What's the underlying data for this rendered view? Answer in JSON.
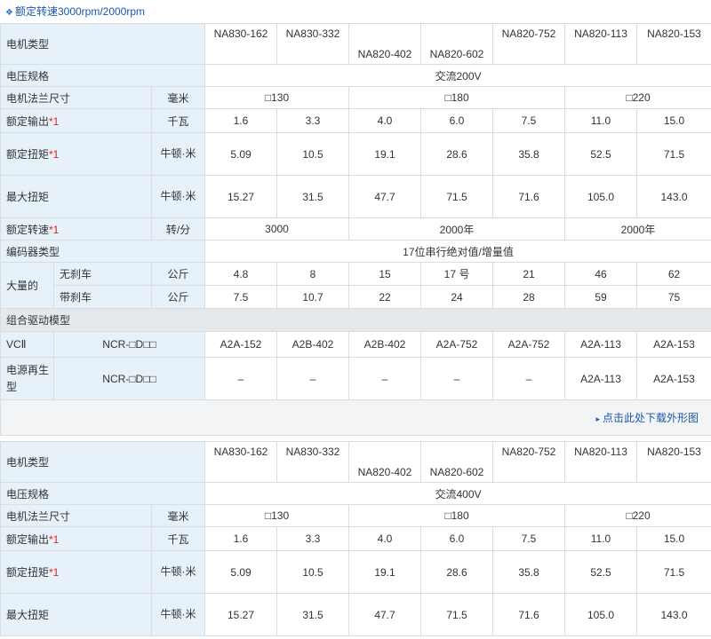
{
  "header": {
    "title": "额定转速3000rpm/2000rpm"
  },
  "labels": {
    "motor_type": "电机类型",
    "voltage": "电压规格",
    "flange": "电机法兰尺寸",
    "output": "额定输出",
    "torque": "额定扭矩",
    "max_torque": "最大扭矩",
    "speed": "额定转速",
    "encoder": "编码器类型",
    "mass": "大量的",
    "no_brake": "无刹车",
    "with_brake": "带刹车",
    "drive_group": "组合驱动模型",
    "vc2": "VCⅡ",
    "regen": "电源再生型",
    "asterisk": "*1"
  },
  "units": {
    "mm": "毫米",
    "kw": "千瓦",
    "nm": "牛顿·米",
    "rpm": "转/分",
    "kg": "公斤"
  },
  "models": [
    "NA830-162",
    "NA830-332",
    "NA820-402",
    "NA820-602",
    "NA820-752",
    "NA820-113",
    "NA820-153"
  ],
  "drive_prefix": "NCR-□D□□",
  "download_link": "点击此处下载外形图",
  "table1": {
    "voltage": "交流200V",
    "flange": [
      "□130",
      "□180",
      "□220"
    ],
    "output": [
      "1.6",
      "3.3",
      "4.0",
      "6.0",
      "7.5",
      "11.0",
      "15.0"
    ],
    "torque": [
      "5.09",
      "10.5",
      "19.1",
      "28.6",
      "35.8",
      "52.5",
      "71.5"
    ],
    "max_torque": [
      "15.27",
      "31.5",
      "47.7",
      "71.5",
      "71.6",
      "105.0",
      "143.0"
    ],
    "speed": [
      "3000",
      "2000年",
      "2000年"
    ],
    "encoder": "17位串行绝对值/增量值",
    "mass_no_brake": [
      "4.8",
      "8",
      "15",
      "17 号",
      "21",
      "46",
      "62"
    ],
    "mass_with_brake": [
      "7.5",
      "10.7",
      "22",
      "24",
      "28",
      "59",
      "75"
    ],
    "drive_vc2": [
      "A2A-152",
      "A2B-402",
      "A2B-402",
      "A2A-752",
      "A2A-752",
      "A2A-113",
      "A2A-153"
    ],
    "drive_regen": [
      "–",
      "–",
      "–",
      "–",
      "–",
      "A2A-113",
      "A2A-153"
    ]
  },
  "table2": {
    "voltage": "交流400V",
    "flange": [
      "□130",
      "□180",
      "□220"
    ],
    "output": [
      "1.6",
      "3.3",
      "4.0",
      "6.0",
      "7.5",
      "11.0",
      "15.0"
    ],
    "torque": [
      "5.09",
      "10.5",
      "19.1",
      "28.6",
      "35.8",
      "52.5",
      "71.5"
    ],
    "max_torque": [
      "15.27",
      "31.5",
      "47.7",
      "71.5",
      "71.6",
      "105.0",
      "143.0"
    ]
  }
}
